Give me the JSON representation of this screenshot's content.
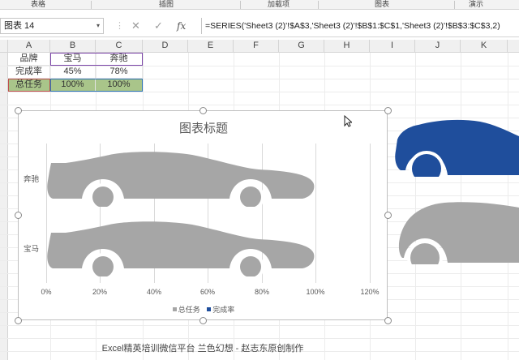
{
  "ribbon": {
    "groups": [
      "表格",
      "插图",
      "加载项",
      "图表",
      "演示"
    ]
  },
  "formula_bar": {
    "name_box": "图表 14",
    "name_dropdown": "▾",
    "cancel_glyph": "✕",
    "enter_glyph": "✓",
    "fx_label": "fx",
    "formula": "=SERIES('Sheet3 (2)'!$A$3,'Sheet3 (2)'!$B$1:$C$1,'Sheet3 (2)'!$B$3:$C$3,2)"
  },
  "columns": [
    "A",
    "B",
    "C",
    "D",
    "E",
    "F",
    "G",
    "H",
    "I",
    "J",
    "K"
  ],
  "table": {
    "header": [
      "品牌",
      "宝马",
      "奔驰"
    ],
    "rows": [
      [
        "完成率",
        "45%",
        "78%"
      ],
      [
        "总任务",
        "100%",
        "100%"
      ]
    ]
  },
  "chart": {
    "title": "图表标题",
    "categories": [
      "奔驰",
      "宝马"
    ],
    "x_ticks": [
      "0%",
      "20%",
      "40%",
      "60%",
      "80%",
      "100%",
      "120%"
    ],
    "legend": [
      "总任务",
      "完成率"
    ],
    "colors": {
      "total": "#a6a6a6",
      "done": "#1f4e9c"
    }
  },
  "chart_data": {
    "type": "bar",
    "orientation": "horizontal",
    "title": "图表标题",
    "categories": [
      "宝马",
      "奔驰"
    ],
    "series": [
      {
        "name": "完成率",
        "values": [
          45,
          78
        ]
      },
      {
        "name": "总任务",
        "values": [
          100,
          100
        ]
      }
    ],
    "xlim": [
      0,
      120
    ],
    "x_ticks": [
      "0%",
      "20%",
      "40%",
      "60%",
      "80%",
      "100%",
      "120%"
    ],
    "grid": true,
    "legend_position": "bottom"
  },
  "caption": "Excel精英培训微信平台 兰色幻想 - 赵志东原创制作"
}
